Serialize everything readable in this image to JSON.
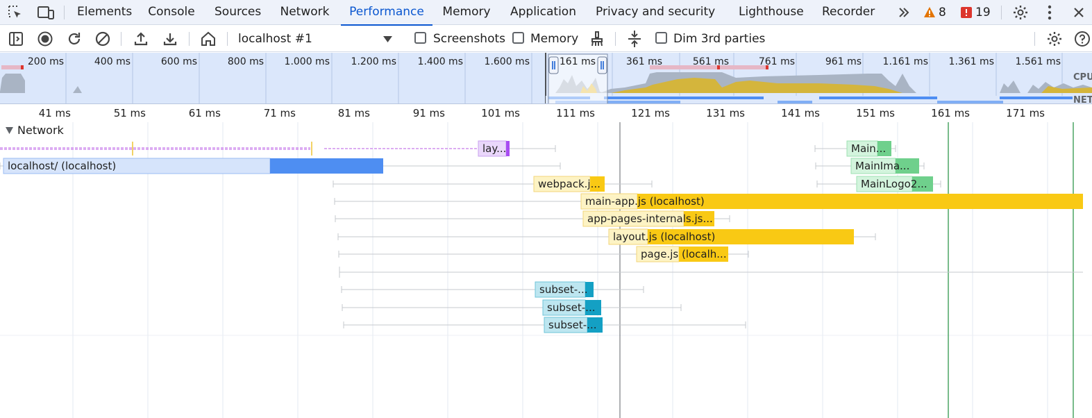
{
  "tabs": [
    {
      "label": "Elements"
    },
    {
      "label": "Console"
    },
    {
      "label": "Sources"
    },
    {
      "label": "Network"
    },
    {
      "label": "Performance"
    },
    {
      "label": "Memory"
    },
    {
      "label": "Application"
    },
    {
      "label": "Privacy and security"
    },
    {
      "label": "Lighthouse"
    },
    {
      "label": "Recorder"
    }
  ],
  "active_tab": "Performance",
  "issues": {
    "warnings": "8",
    "errors": "19"
  },
  "toolbar": {
    "profile": "localhost #1",
    "screenshots_label": "Screenshots",
    "memory_label": "Memory",
    "dim_label": "Dim 3rd parties"
  },
  "overview": {
    "ticks_left": [
      "200 ms",
      "400 ms",
      "600 ms",
      "800 ms",
      "1.000 ms",
      "1.200 ms",
      "1.400 ms",
      "1.600 ms"
    ],
    "ticks_right": [
      "161 ms",
      "361 ms",
      "561 ms",
      "761 ms",
      "961 ms",
      "1.161 ms",
      "1.361 ms",
      "1.561 ms"
    ],
    "cpu_label": "CPU",
    "net_label": "NET"
  },
  "ruler_ticks": [
    "41 ms",
    "51 ms",
    "61 ms",
    "71 ms",
    "81 ms",
    "91 ms",
    "101 ms",
    "111 ms",
    "121 ms",
    "131 ms",
    "141 ms",
    "151 ms",
    "161 ms",
    "171 ms"
  ],
  "network_section": "Network",
  "requests": [
    {
      "label": "lay...",
      "kind": "doc-purple"
    },
    {
      "label": "localhost/ (localhost)",
      "kind": "html"
    },
    {
      "label": "webpack.j...",
      "kind": "script"
    },
    {
      "label": "main-app.js (localhost)",
      "kind": "script"
    },
    {
      "label": "app-pages-internals.js...",
      "kind": "script"
    },
    {
      "label": "layout.js (localhost)",
      "kind": "script"
    },
    {
      "label": "page.js (localh...",
      "kind": "script"
    },
    {
      "label": "subset-...",
      "kind": "font"
    },
    {
      "label": "subset-...",
      "kind": "font"
    },
    {
      "label": "subset-...",
      "kind": "font"
    },
    {
      "label": "Main...",
      "kind": "image"
    },
    {
      "label": "MainIma...",
      "kind": "image"
    },
    {
      "label": "MainLogo2...",
      "kind": "image"
    }
  ],
  "colors": {
    "accent": "#0b57d0",
    "html_light": "#d6e4fb",
    "html_dark": "#4e8ef2",
    "script_light": "#fdf3c4",
    "script_dark": "#f9c914",
    "font_light": "#bde6f0",
    "font_dark": "#14a0c4",
    "image_light": "#d3f4dd",
    "image_dark": "#6fd08c",
    "purple_light": "#ead7fb",
    "purple_dark": "#a84cf2",
    "marker_green": "#1e8e3e"
  }
}
